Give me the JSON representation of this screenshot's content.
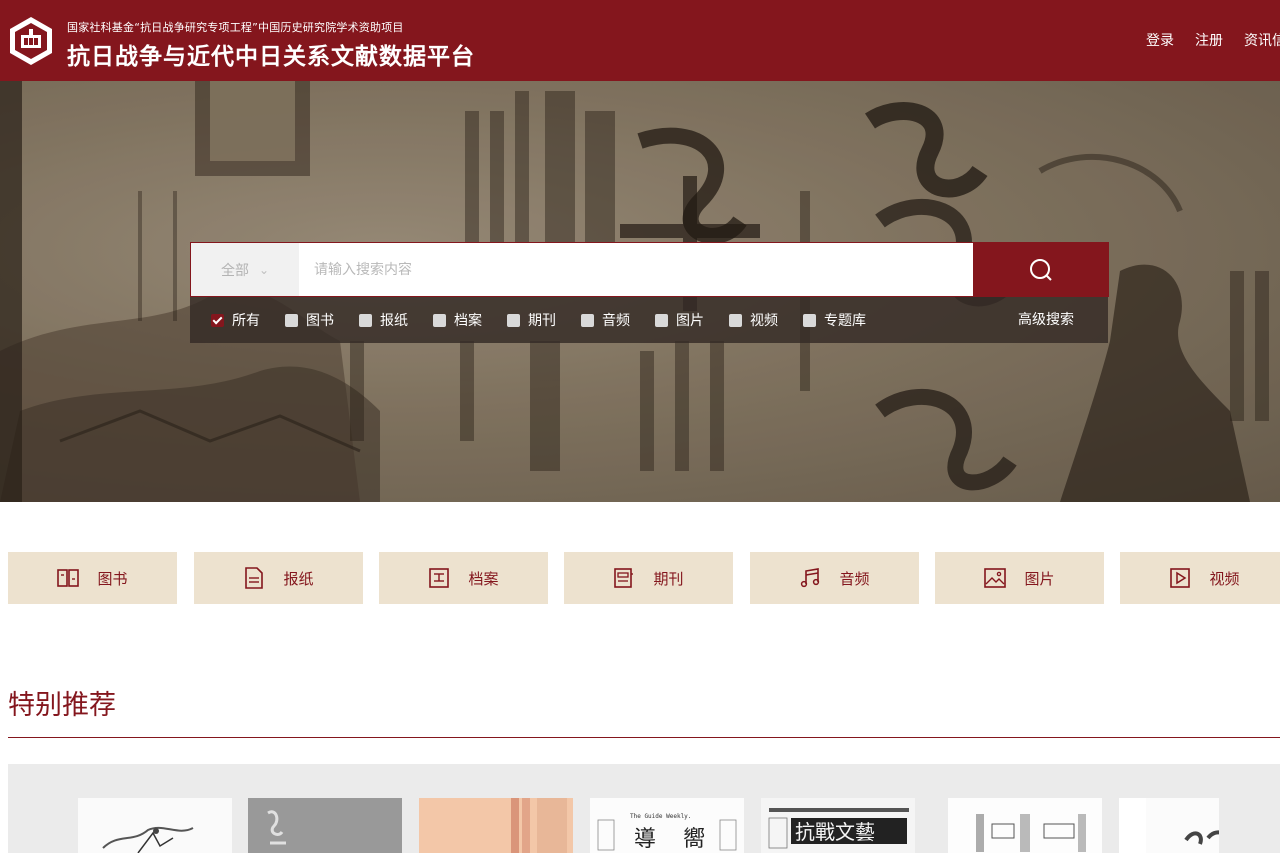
{
  "header": {
    "subtitle": "国家社科基金“抗日战争研究专项工程”中国历史研究院学术资助项目",
    "title": "抗日战争与近代中日关系文献数据平台",
    "nav": [
      {
        "label": "登录"
      },
      {
        "label": "注册"
      },
      {
        "label": "资讯信息"
      }
    ]
  },
  "search": {
    "scope_label": "全部",
    "placeholder": "请输入搜索内容",
    "filters": [
      {
        "label": "所有",
        "checked": true
      },
      {
        "label": "图书",
        "checked": false
      },
      {
        "label": "报纸",
        "checked": false
      },
      {
        "label": "档案",
        "checked": false
      },
      {
        "label": "期刊",
        "checked": false
      },
      {
        "label": "音频",
        "checked": false
      },
      {
        "label": "图片",
        "checked": false
      },
      {
        "label": "视频",
        "checked": false
      },
      {
        "label": "专题库",
        "checked": false
      }
    ],
    "advanced_label": "高级搜索"
  },
  "categories": [
    {
      "label": "图书",
      "icon": "book-icon"
    },
    {
      "label": "报纸",
      "icon": "newspaper-icon"
    },
    {
      "label": "档案",
      "icon": "archive-icon"
    },
    {
      "label": "期刊",
      "icon": "journal-icon"
    },
    {
      "label": "音频",
      "icon": "music-icon"
    },
    {
      "label": "图片",
      "icon": "image-icon"
    },
    {
      "label": "视频",
      "icon": "video-icon"
    }
  ],
  "featured": {
    "title": "特别推荐",
    "book_cover_texts": [
      "The Guide Weekly.",
      "導 嚮",
      "抗戰文藝"
    ]
  },
  "colors": {
    "brand": "#84161d",
    "tile_bg": "#ede2cf",
    "filter_bar": "#342b26"
  }
}
